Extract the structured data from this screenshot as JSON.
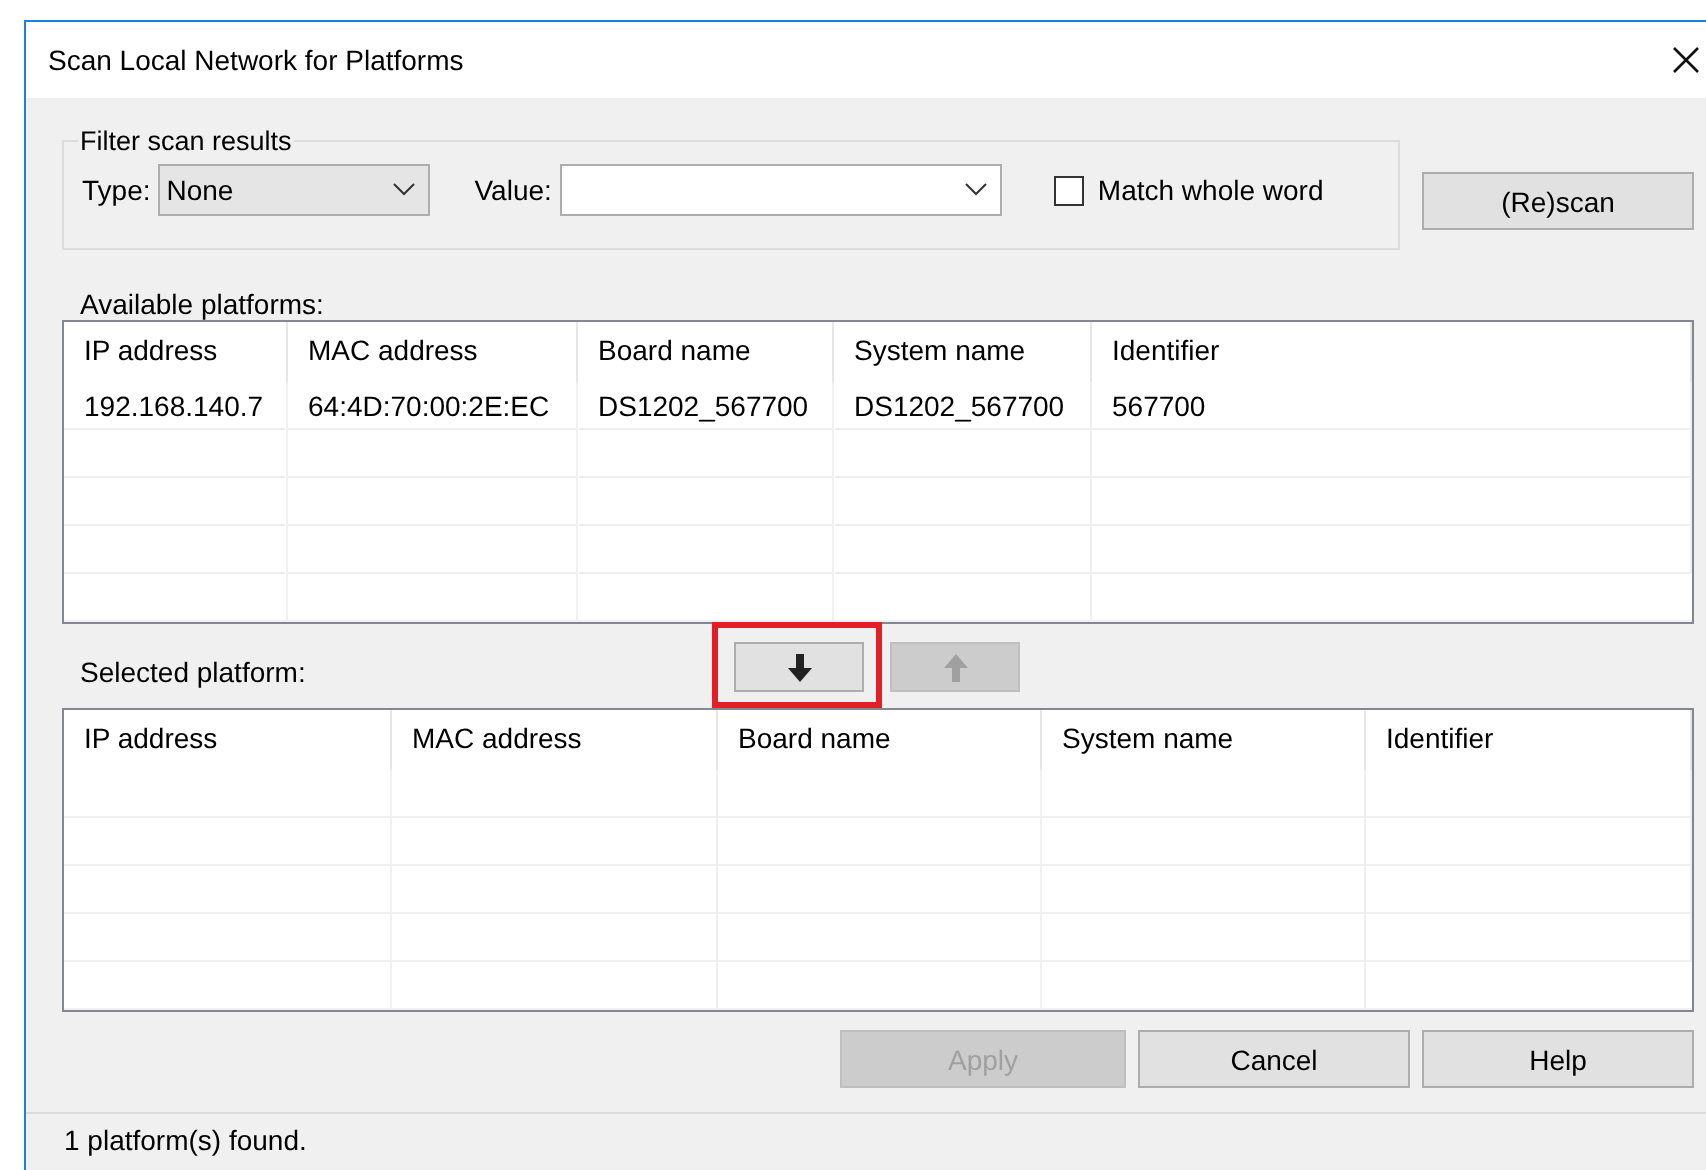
{
  "window": {
    "title": "Scan Local Network for Platforms"
  },
  "filter": {
    "title": "Filter scan results",
    "type_label": "Type:",
    "type_value": "None",
    "value_label": "Value:",
    "match_whole_word": {
      "label": "Match whole word",
      "checked": false
    }
  },
  "rescan_button": "(Re)scan",
  "available": {
    "label": "Available platforms:",
    "columns": [
      "IP address",
      "MAC address",
      "Board name",
      "System name",
      "Identifier"
    ],
    "rows": [
      [
        "192.168.140.7",
        "64:4D:70:00:2E:EC",
        "DS1202_567700",
        "DS1202_567700",
        "567700"
      ]
    ]
  },
  "move_buttons": [
    {
      "kind": "down",
      "disabled": false,
      "highlighted": true
    },
    {
      "kind": "up",
      "disabled": true,
      "highlighted": false
    }
  ],
  "selected": {
    "label": "Selected platform:",
    "columns": [
      "IP address",
      "MAC address",
      "Board name",
      "System name",
      "Identifier"
    ]
  },
  "buttons": [
    {
      "label": "Apply",
      "disabled": true
    },
    {
      "label": "Cancel",
      "disabled": false
    },
    {
      "label": "Help",
      "disabled": false
    }
  ],
  "status_bar": "1 platform(s) found."
}
